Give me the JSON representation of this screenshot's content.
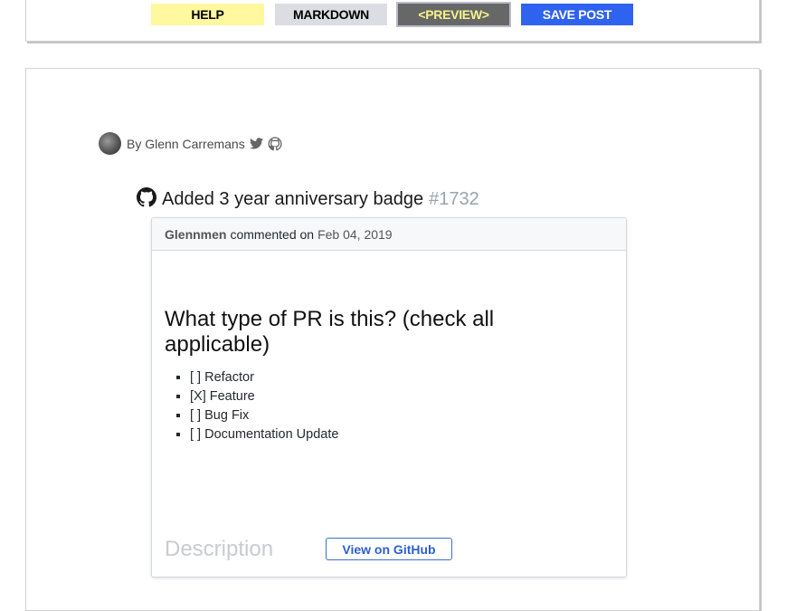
{
  "toolbar": {
    "help_label": "HELP",
    "markdown_label": "MARKDOWN",
    "preview_label": "<PREVIEW>",
    "save_label": "SAVE POST"
  },
  "author": {
    "byline": "By Glenn Carremans",
    "icons": [
      "twitter-icon",
      "github-icon"
    ]
  },
  "pr": {
    "title": "Added 3 year anniversary badge",
    "number": "#1732",
    "icon": "github-icon",
    "comment": {
      "user": "Glennmen",
      "action": "commented on",
      "date": "Feb 04, 2019",
      "heading": "What type of PR is this? (check all applicable)",
      "checklist": [
        "[ ] Refactor",
        "[X] Feature",
        "[ ] Bug Fix",
        "[ ] Documentation Update"
      ],
      "next_heading": "Description",
      "view_button": "View on GitHub"
    }
  },
  "colors": {
    "help_bg": "#fff89e",
    "markdown_bg": "#dcdde3",
    "preview_bg": "#676767",
    "preview_text": "#f5f48a",
    "save_bg": "#2f62ef",
    "link_blue": "#2a5fd0"
  }
}
